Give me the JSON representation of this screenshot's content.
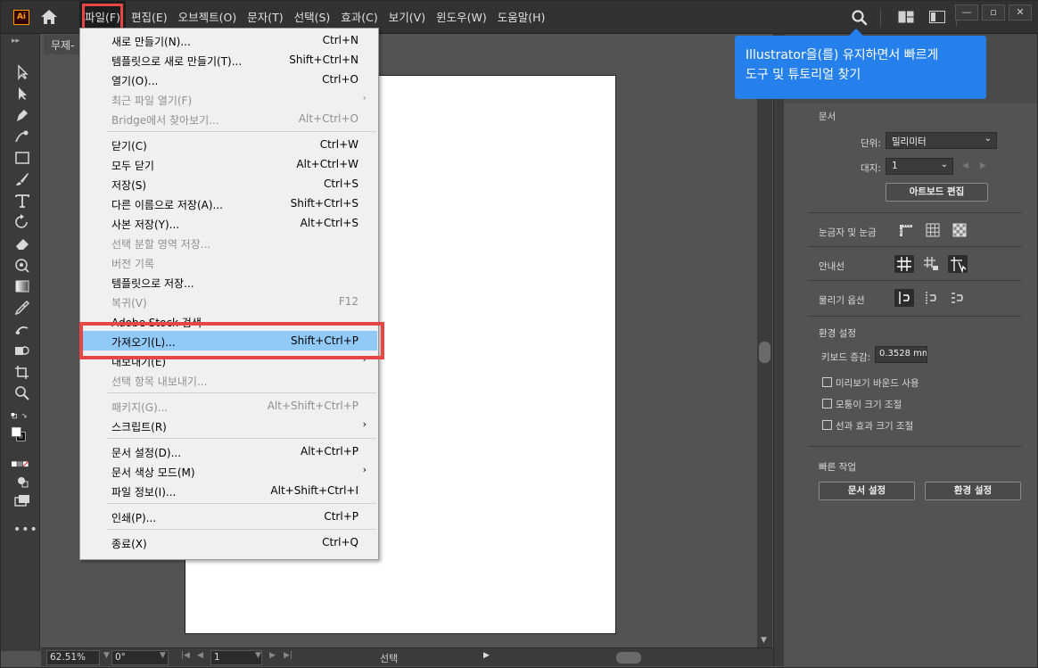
{
  "app": {
    "logo": "Ai"
  },
  "menubar": {
    "items": [
      {
        "label": "파일(F)"
      },
      {
        "label": "편집(E)"
      },
      {
        "label": "오브젝트(O)"
      },
      {
        "label": "문자(T)"
      },
      {
        "label": "선택(S)"
      },
      {
        "label": "효과(C)"
      },
      {
        "label": "보기(V)"
      },
      {
        "label": "윈도우(W)"
      },
      {
        "label": "도움말(H)"
      }
    ],
    "window_buttons": {
      "minimize": "—",
      "restore": "▫",
      "close": "✕"
    }
  },
  "document": {
    "tab_title": "무제-"
  },
  "tooltip": {
    "line1": "Illustrator을(를) 유지하면서 빠르게",
    "line2": "도구 및 튜토리얼 찾기"
  },
  "file_menu": {
    "items": [
      {
        "label": "새로 만들기(N)...",
        "shortcut": "Ctrl+N",
        "disabled": false,
        "submenu": false
      },
      {
        "label": "템플릿으로 새로 만들기(T)...",
        "shortcut": "Shift+Ctrl+N",
        "disabled": false,
        "submenu": false
      },
      {
        "label": "열기(O)...",
        "shortcut": "Ctrl+O",
        "disabled": false,
        "submenu": false
      },
      {
        "label": "최근 파일 열기(F)",
        "shortcut": "",
        "disabled": true,
        "submenu": true
      },
      {
        "label": "Bridge에서 찾아보기...",
        "shortcut": "Alt+Ctrl+O",
        "disabled": true,
        "submenu": false
      },
      {
        "sep": true
      },
      {
        "label": "닫기(C)",
        "shortcut": "Ctrl+W",
        "disabled": false,
        "submenu": false
      },
      {
        "label": "모두 닫기",
        "shortcut": "Alt+Ctrl+W",
        "disabled": false,
        "submenu": false
      },
      {
        "label": "저장(S)",
        "shortcut": "Ctrl+S",
        "disabled": false,
        "submenu": false
      },
      {
        "label": "다른 이름으로 저장(A)...",
        "shortcut": "Shift+Ctrl+S",
        "disabled": false,
        "submenu": false
      },
      {
        "label": "사본 저장(Y)...",
        "shortcut": "Alt+Ctrl+S",
        "disabled": false,
        "submenu": false
      },
      {
        "label": "선택 분할 영역 저장...",
        "shortcut": "",
        "disabled": true,
        "submenu": false
      },
      {
        "label": "버전 기록",
        "shortcut": "",
        "disabled": true,
        "submenu": false
      },
      {
        "label": "템플릿으로 저장...",
        "shortcut": "",
        "disabled": false,
        "submenu": false
      },
      {
        "label": "복귀(V)",
        "shortcut": "F12",
        "disabled": true,
        "submenu": false
      },
      {
        "label": "Adobe Stock 검색",
        "shortcut": "",
        "disabled": false,
        "submenu": false
      },
      {
        "label": "가져오기(L)...",
        "shortcut": "Shift+Ctrl+P",
        "disabled": false,
        "submenu": false,
        "highlight": true
      },
      {
        "label": "내보내기(E)",
        "shortcut": "",
        "disabled": false,
        "submenu": true
      },
      {
        "label": "선택 항목 내보내기...",
        "shortcut": "",
        "disabled": true,
        "submenu": false
      },
      {
        "sep": true
      },
      {
        "label": "패키지(G)...",
        "shortcut": "Alt+Shift+Ctrl+P",
        "disabled": true,
        "submenu": false
      },
      {
        "label": "스크립트(R)",
        "shortcut": "",
        "disabled": false,
        "submenu": true
      },
      {
        "sep": true
      },
      {
        "label": "문서 설정(D)...",
        "shortcut": "Alt+Ctrl+P",
        "disabled": false,
        "submenu": false
      },
      {
        "label": "문서 색상 모드(M)",
        "shortcut": "",
        "disabled": false,
        "submenu": true
      },
      {
        "label": "파일 정보(I)...",
        "shortcut": "Alt+Shift+Ctrl+I",
        "disabled": false,
        "submenu": false
      },
      {
        "sep": true
      },
      {
        "label": "인쇄(P)...",
        "shortcut": "Ctrl+P",
        "disabled": false,
        "submenu": false
      },
      {
        "sep": true
      },
      {
        "label": "종료(X)",
        "shortcut": "Ctrl+Q",
        "disabled": false,
        "submenu": false
      }
    ]
  },
  "properties_panel": {
    "document_section": "문서",
    "unit_label": "단위:",
    "unit_value": "밀리미터",
    "artboard_label": "대지:",
    "artboard_value": "1",
    "edit_artboard_button": "아트보드 편집",
    "rulers_grids_label": "눈금자 및 눈금",
    "guides_label": "안내선",
    "snap_options_label": "물리기 옵션",
    "preferences_section": "환경 설정",
    "keyboard_increment_label": "키보드 증감:",
    "keyboard_increment_value": "0.3528 mm",
    "preview_bounds_label": "미리보기 바운드 사용",
    "scale_corners_label": "모퉁이 크기 조절",
    "scale_strokes_label": "선과 효과 크기 조절",
    "quick_actions_section": "빠른 작업",
    "doc_setup_button": "문서 설정",
    "preferences_button": "환경 설정"
  },
  "statusbar": {
    "zoom": "62.51%",
    "rotation": "0°",
    "artboard_nav": "1",
    "status_text": "선택"
  },
  "colors": {
    "accent": "#2680eb",
    "highlight_row": "#91c9f7",
    "annotation_red": "#e84545",
    "ui_dark": "#323232",
    "panel": "#535353"
  }
}
